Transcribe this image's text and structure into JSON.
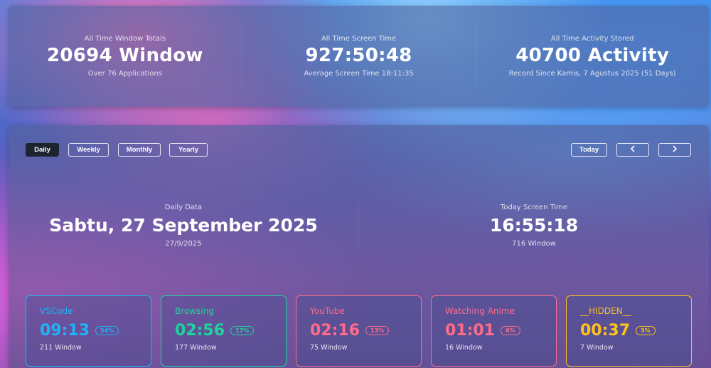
{
  "summary": [
    {
      "label": "All Time Window Totals",
      "value": "20694 Window",
      "sub": "Over 76 Applications"
    },
    {
      "label": "All Time Screen Time",
      "value": "927:50:48",
      "sub": "Average Screen Time 18:11:35"
    },
    {
      "label": "All Time Activity Stored",
      "value": "40700 Activity",
      "sub": "Record Since Kamis, 7 Agustus 2025 (51 Days)"
    }
  ],
  "periods": [
    "Daily",
    "Weekly",
    "Monthly",
    "Yearly"
  ],
  "active_period": "Daily",
  "nav": {
    "today": "Today",
    "prev_icon": "chevron-left-icon",
    "next_icon": "chevron-right-icon"
  },
  "daily": {
    "label": "Daily Data",
    "date": "Sabtu, 27 September 2025",
    "date_short": "27/9/2025"
  },
  "today": {
    "label": "Today Screen Time",
    "time": "16:55:18",
    "windows": "716 Window"
  },
  "categories": [
    {
      "name": "VSCode",
      "time": "09:13",
      "percent": "54%",
      "windows": "211 Window",
      "color": "#1fb3f5"
    },
    {
      "name": "Browsing",
      "time": "02:56",
      "percent": "17%",
      "windows": "177 Window",
      "color": "#1ed49a"
    },
    {
      "name": "YouTube",
      "time": "02:16",
      "percent": "13%",
      "windows": "75 Window",
      "color": "#ff6b8a"
    },
    {
      "name": "Watching Anime",
      "time": "01:01",
      "percent": "6%",
      "windows": "16 Window",
      "color": "#ff6b8a"
    },
    {
      "name": "__HIDDEN__",
      "time": "00:37",
      "percent": "3%",
      "windows": "7 Window",
      "color": "#ffc21a"
    }
  ]
}
